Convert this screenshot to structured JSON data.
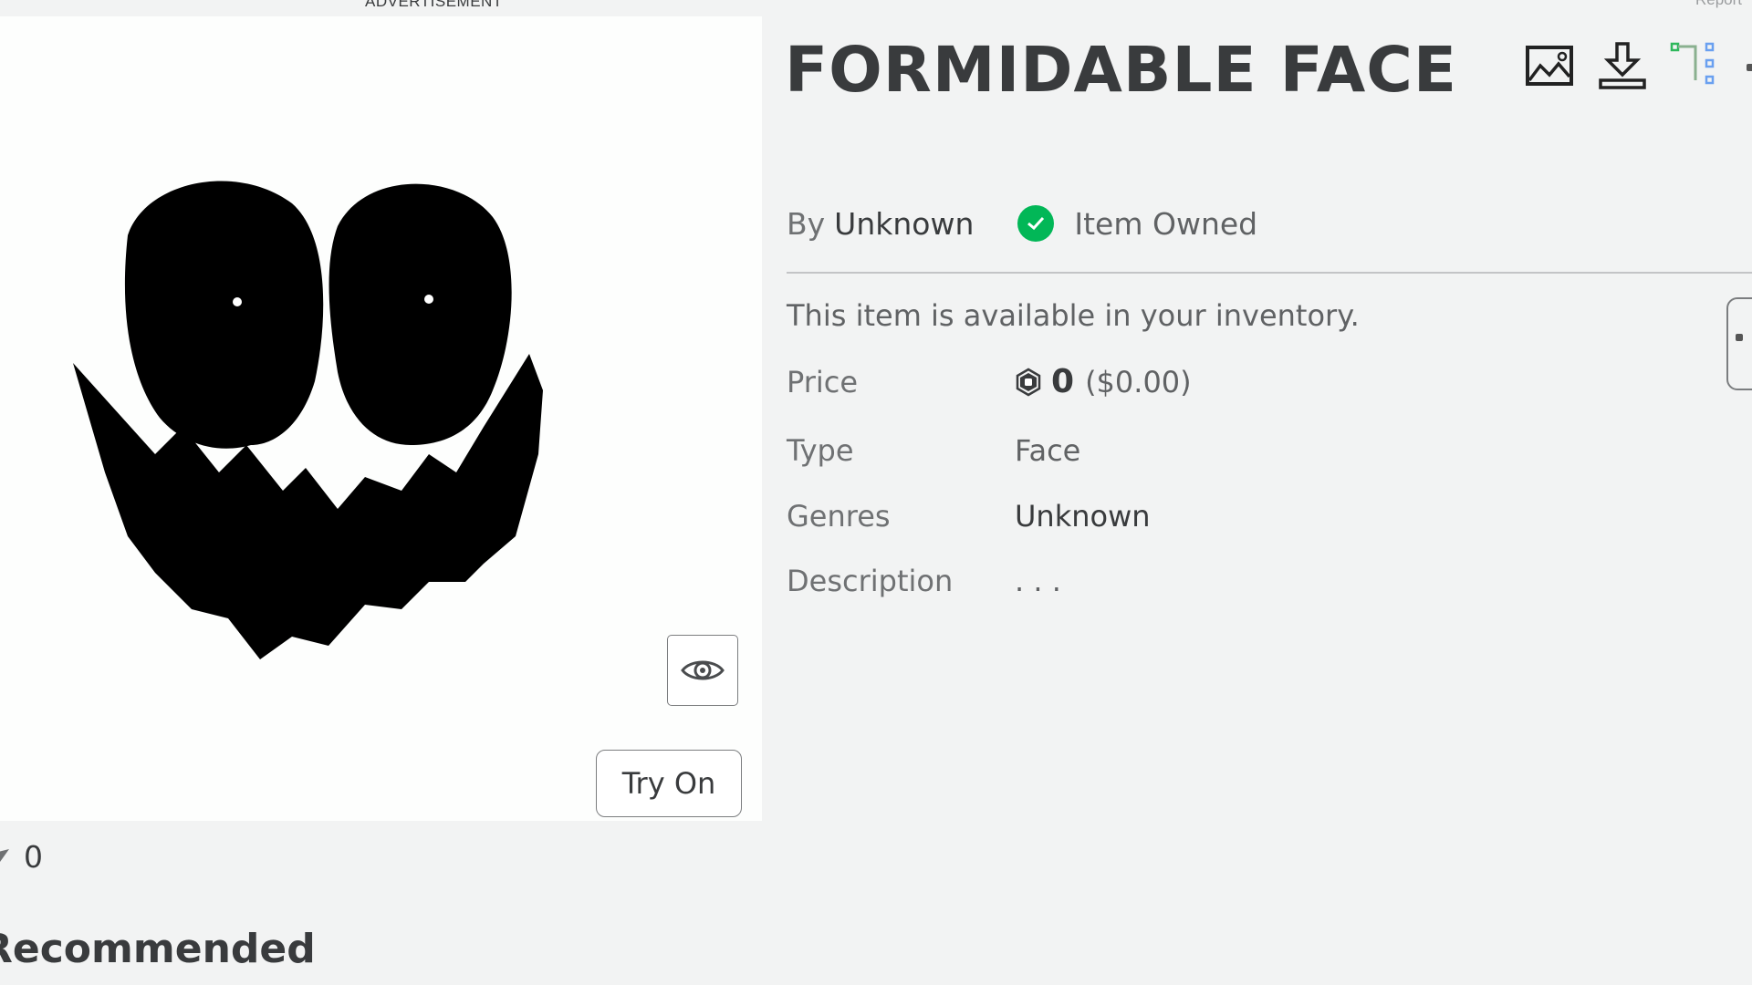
{
  "ad": {
    "label": "ADVERTISEMENT"
  },
  "header": {
    "report_label": "Report"
  },
  "item": {
    "title": "FORMIDABLE FACE",
    "by_prefix": "By",
    "creator": "Unknown",
    "owned_label": "Item Owned",
    "availability": "This item is available in your inventory.",
    "fields": [
      {
        "label": "Price",
        "robux": "0",
        "usd": "($0.00)"
      },
      {
        "label": "Type",
        "value": "Face"
      },
      {
        "label": "Genres",
        "value": "Unknown"
      },
      {
        "label": "Description",
        "value": ". . ."
      }
    ]
  },
  "thumbnail": {
    "try_on_label": "Try On",
    "favorite_count": "0"
  },
  "sections": {
    "recommended": "Recommended"
  },
  "toolbar": {
    "icons": [
      "image-icon",
      "download-icon",
      "hierarchy-icon"
    ]
  },
  "colors": {
    "owned_green": "#02b757",
    "text_dark": "#393b3d",
    "page_bg": "#f2f3f3"
  }
}
